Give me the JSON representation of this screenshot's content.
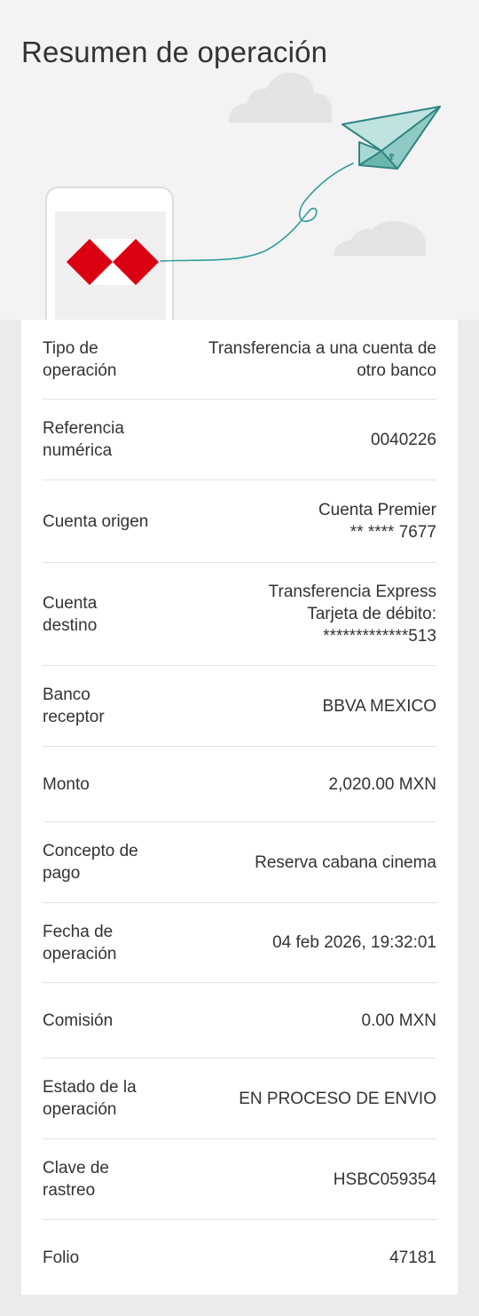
{
  "header": {
    "title": "Resumen de operación"
  },
  "colors": {
    "brand_red": "#db0011",
    "accent_teal": "#2f9c9a",
    "accent_teal_light": "#a9d8d3",
    "hero_background": "#f3f3f3",
    "cloud": "#e4e4e4"
  },
  "icons": {
    "logo": "hsbc-hexagon-logo",
    "plane": "paper-plane-icon",
    "phone": "phone-illustration"
  },
  "details": [
    {
      "label": "Tipo de\noperación",
      "value": "Transferencia a una cuenta de\notro banco"
    },
    {
      "label": "Referencia\nnumérica",
      "value": "0040226"
    },
    {
      "label": "Cuenta origen",
      "value": "Cuenta Premier\n** **** 7677"
    },
    {
      "label": "Cuenta\ndestino",
      "value": "Transferencia Express\nTarjeta de débito:\n*************513"
    },
    {
      "label": "Banco\nreceptor",
      "value": "BBVA MEXICO"
    },
    {
      "label": "Monto",
      "value": "2,020.00 MXN"
    },
    {
      "label": "Concepto de\npago",
      "value": "Reserva cabana cinema"
    },
    {
      "label": "Fecha de\noperación",
      "value": "04 feb 2026, 19:32:01"
    },
    {
      "label": "Comisión",
      "value": "0.00 MXN"
    },
    {
      "label": "Estado de la\noperación",
      "value": "EN PROCESO DE ENVIO"
    },
    {
      "label": "Clave de\nrastreo",
      "value": "HSBC059354"
    },
    {
      "label": "Folio",
      "value": "47181"
    }
  ]
}
